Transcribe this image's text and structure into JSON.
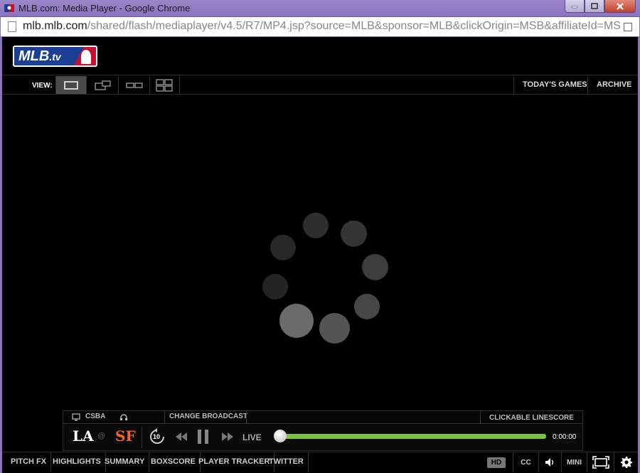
{
  "window": {
    "title": "MLB.com: Media Player - Google Chrome",
    "url_host": "mlb.mlb.com",
    "url_path": "/shared/flash/mediaplayer/v4.5/R7/MP4.jsp?source=MLB&sponsor=MLB&clickOrigin=MSB&affiliateId=MS"
  },
  "header": {
    "logo_main": "MLB",
    "logo_suffix": ".tv"
  },
  "viewbar": {
    "label": "VIEW:",
    "todays_games": "TODAY'S GAMES",
    "archive": "ARCHIVE"
  },
  "player": {
    "broadcast": "CSBA",
    "change_broadcast": "CHANGE BROADCAST",
    "linescore": "CLICKABLE LINESCORE",
    "away_team": "LA",
    "at": "@",
    "home_team": "SF",
    "rewind_seconds": "10",
    "live": "LIVE",
    "time": "0:00:00",
    "progress": 0.0,
    "colors": {
      "progress": "#7dc242",
      "away": "#ffffff",
      "home": "#f26522"
    }
  },
  "bottombar": {
    "items": [
      "PITCH FX",
      "HIGHLIGHTS",
      "SUMMARY",
      "BOXSCORE",
      "PLAYER TRACKER",
      "TWITTER"
    ],
    "hd": "HD",
    "cc": "CC",
    "mini": "MINI"
  }
}
